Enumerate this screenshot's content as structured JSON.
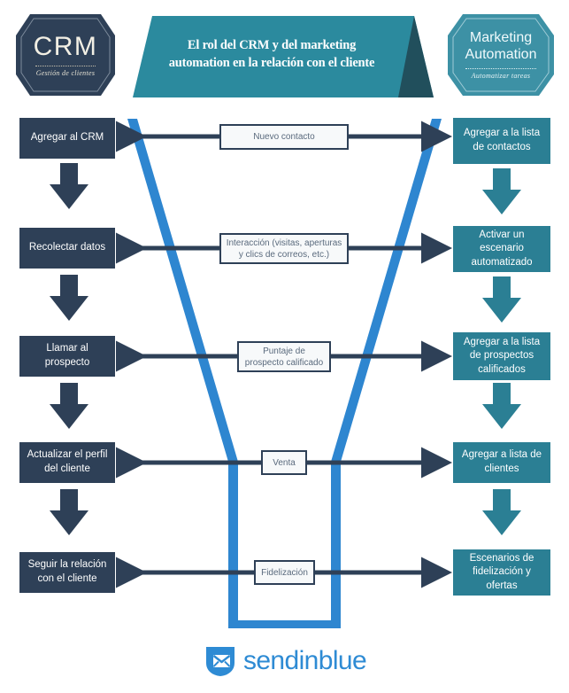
{
  "header": {
    "crm_badge": {
      "title": "CRM",
      "subtitle": "Gestión de clientes",
      "bg_color": "#2e4057"
    },
    "title_banner": {
      "text": "El rol del CRM y del marketing automation en la relación con el cliente",
      "bg_color": "#2b8a9e",
      "fold_color": "#214f5c"
    },
    "ma_badge": {
      "title_line1": "Marketing",
      "title_line2": "Automation",
      "subtitle": "Automatizar tareas",
      "bg_color": "#3d91a5"
    }
  },
  "colors": {
    "crm_navy": "#2e4057",
    "ma_teal": "#2b7f94",
    "funnel_blue": "#2e86d0",
    "logo_blue": "#2e8bd4",
    "center_box_bg": "#f7f9fa"
  },
  "flow": {
    "left_column_title": "CRM",
    "right_column_title": "Marketing Automation",
    "rows": [
      {
        "center": "Nuevo contacto",
        "left": "Agregar al CRM",
        "right": "Agregar a la lista de contactos"
      },
      {
        "center": "Interacción (visitas, aperturas y clics de correos, etc.)",
        "left": "Recolectar datos",
        "right": "Activar un escenario automatizado"
      },
      {
        "center": "Puntaje de prospecto calificado",
        "left": "Llamar al prospecto",
        "right": "Agregar a la lista de prospectos calificados"
      },
      {
        "center": "Venta",
        "left": "Actualizar el perfil del cliente",
        "right": "Agregar a lista de clientes"
      },
      {
        "center": "Fidelización",
        "left": "Seguir la relación con el cliente",
        "right": "Escenarios de fidelización y ofertas"
      }
    ]
  },
  "footer": {
    "brand": "sendinblue",
    "icon": "sendinblue-envelope-shield-icon"
  }
}
